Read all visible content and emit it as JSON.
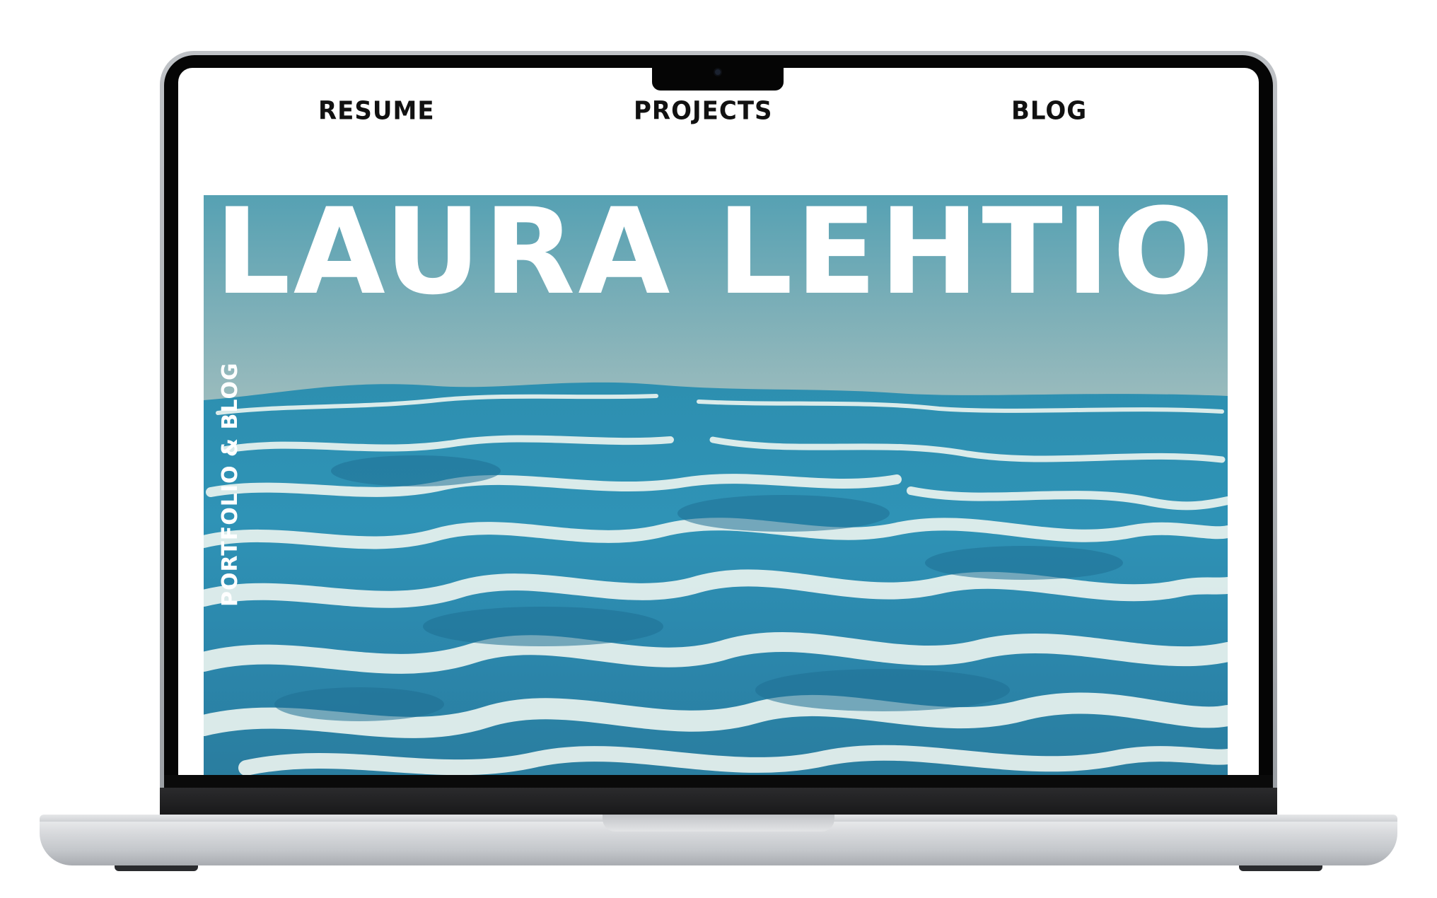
{
  "nav": {
    "items": [
      {
        "label": "RESUME"
      },
      {
        "label": "PROJECTS"
      },
      {
        "label": "BLOG"
      }
    ]
  },
  "hero": {
    "title": "LAURA LEHTIO",
    "subtitle": "PORTFOLIO & BLOG",
    "image": "ocean-waves-photo"
  },
  "device": "laptop-mockup",
  "colors": {
    "sky": "#7fb0b8",
    "water": "#2c8fae",
    "highlight": "#eaf4f1",
    "nav_text": "#111111",
    "title_text": "#ffffff"
  }
}
